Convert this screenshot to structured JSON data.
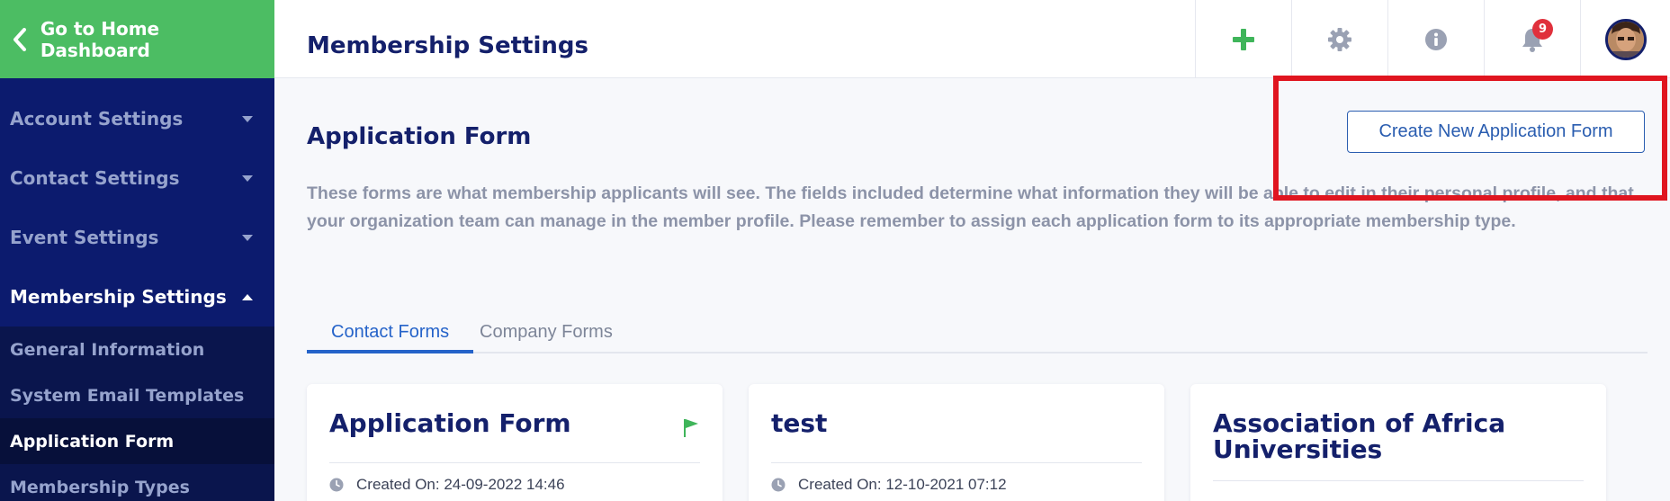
{
  "sidebar": {
    "home_label": "Go to Home Dashboard",
    "items": [
      {
        "label": "Account Settings",
        "expanded": false
      },
      {
        "label": "Contact Settings",
        "expanded": false
      },
      {
        "label": "Event Settings",
        "expanded": false
      },
      {
        "label": "Membership Settings",
        "expanded": true
      }
    ],
    "subitems": [
      {
        "label": "General Information",
        "active": false
      },
      {
        "label": "System Email Templates",
        "active": false
      },
      {
        "label": "Application Form",
        "active": true
      },
      {
        "label": "Membership Types",
        "active": false
      }
    ]
  },
  "header": {
    "title": "Membership Settings",
    "notification_count": "9",
    "icons": [
      "plus-icon",
      "gear-icon",
      "info-icon",
      "bell-icon",
      "avatar"
    ]
  },
  "main": {
    "section_title": "Application Form",
    "create_button_label": "Create New Application Form",
    "description": "These forms are what membership applicants will see. The fields included determine what information they will be able to edit in their personal profile, and that your organization team can manage in the member profile. Please remember to assign each application form to its appropriate membership type.",
    "tabs": [
      {
        "label": "Contact Forms",
        "active": true
      },
      {
        "label": "Company Forms",
        "active": false
      }
    ],
    "cards": [
      {
        "title": "Application Form",
        "created": "Created On: 24-09-2022 14:46",
        "flagged": true
      },
      {
        "title": "test",
        "created": "Created On: 12-10-2021 07:12",
        "flagged": false
      },
      {
        "title": "Association of Africa Universities",
        "created": "",
        "flagged": false
      }
    ]
  },
  "colors": {
    "sidebar_bg": "#0c1b6e",
    "home_green": "#4cbd63",
    "accent_blue": "#2563c9",
    "title_navy": "#14206b",
    "badge_red": "#e0303c",
    "highlight_red": "#e0151f"
  }
}
